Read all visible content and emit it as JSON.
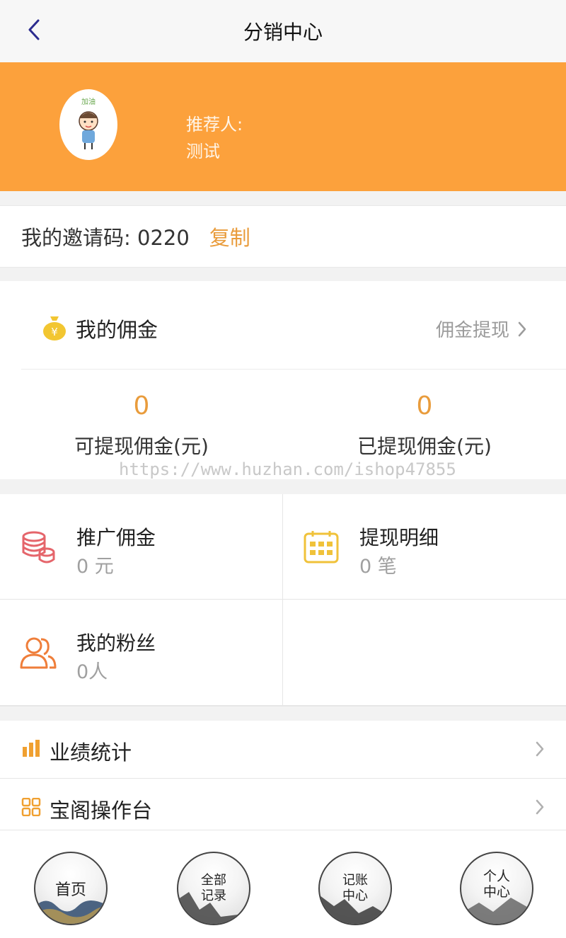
{
  "navbar": {
    "title": "分销中心",
    "back_icon": "chevron-left-icon"
  },
  "profile": {
    "referrer_label": "推荐人:",
    "referrer_name": "测试",
    "avatar_text": "加油"
  },
  "invite": {
    "label": "我的邀请码: 0220",
    "copy_label": "复制"
  },
  "commission": {
    "title": "我的佣金",
    "withdraw_link": "佣金提现",
    "stats": [
      {
        "value": "0",
        "caption": "可提现佣金(元)"
      },
      {
        "value": "0",
        "caption": "已提现佣金(元)"
      }
    ],
    "watermark": "https://www.huzhan.com/ishop47855"
  },
  "grid": [
    {
      "name": "推广佣金",
      "value": "0 元",
      "icon": "coins-stack-icon",
      "color": "#e5656b"
    },
    {
      "name": "提现明细",
      "value": "0 笔",
      "icon": "calendar-icon",
      "color": "#f0c23a"
    },
    {
      "name": "我的粉丝",
      "value": "0人",
      "icon": "users-icon",
      "color": "#ef7e3a"
    }
  ],
  "menu": [
    {
      "label": "业绩统计",
      "icon": "bar-chart-icon"
    },
    {
      "label": "宝阁操作台",
      "icon": "grid-icon"
    }
  ],
  "tabbar": [
    {
      "label": "首页"
    },
    {
      "label_line1": "全部",
      "label_line2": "记录"
    },
    {
      "label_line1": "记账",
      "label_line2": "中心"
    },
    {
      "label_line1": "个人",
      "label_line2": "中心"
    }
  ],
  "colors": {
    "accent": "#fca13c",
    "highlight": "#e99c3c"
  }
}
